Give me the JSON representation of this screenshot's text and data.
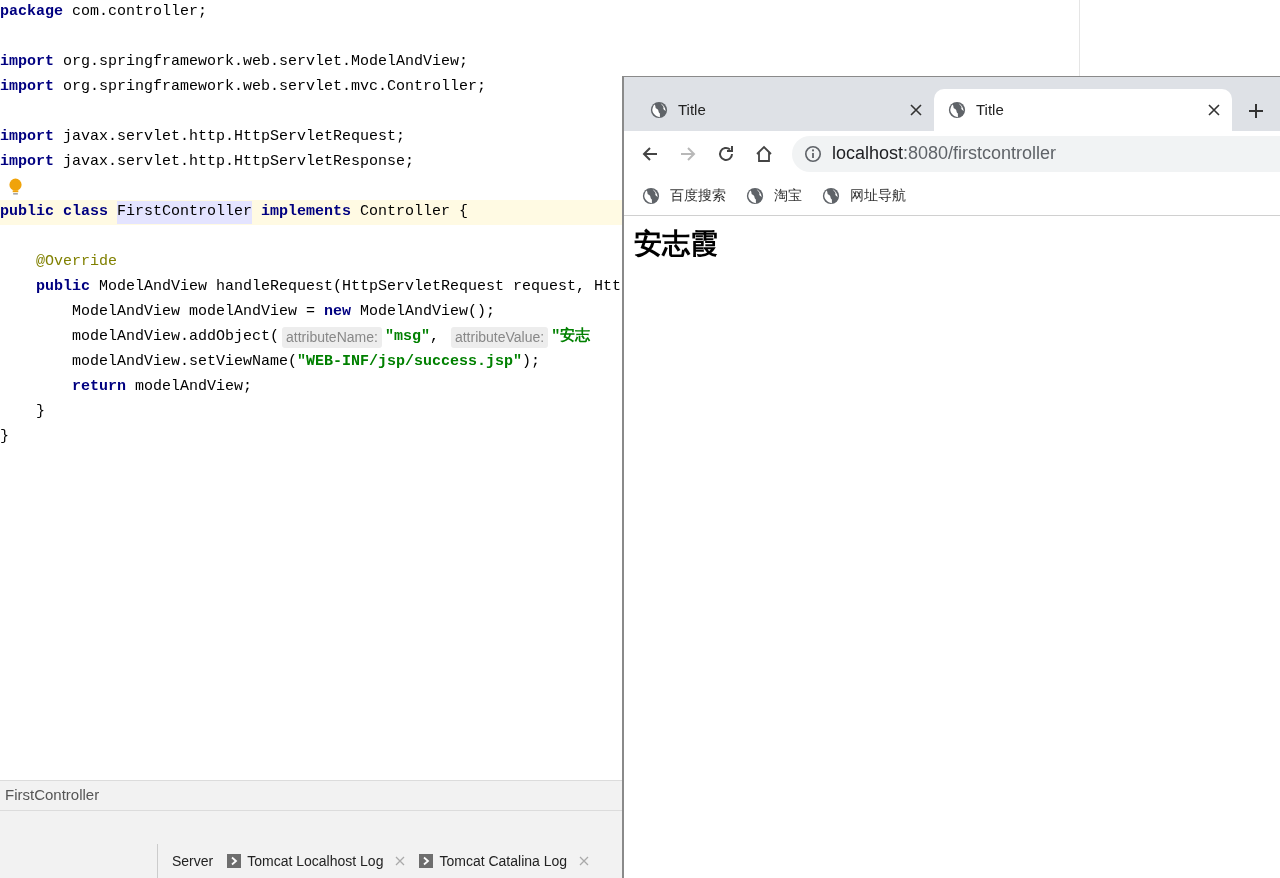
{
  "editor": {
    "lines": [
      {
        "current": false,
        "tokens": [
          {
            "kind": "keyword",
            "text": "package"
          },
          {
            "kind": "plain",
            "text": " com.controller;"
          }
        ]
      },
      {
        "current": false
      },
      {
        "current": false,
        "tokens": [
          {
            "kind": "keyword",
            "text": "import"
          },
          {
            "kind": "plain",
            "text": " org.springframework.web.servlet.ModelAndView;"
          }
        ]
      },
      {
        "current": false,
        "tokens": [
          {
            "kind": "keyword",
            "text": "import"
          },
          {
            "kind": "plain",
            "text": " org.springframework.web.servlet.mvc.Controller;"
          }
        ]
      },
      {
        "current": false
      },
      {
        "current": false,
        "tokens": [
          {
            "kind": "keyword",
            "text": "import"
          },
          {
            "kind": "plain",
            "text": " javax.servlet.http.HttpServletRequest;"
          }
        ]
      },
      {
        "current": false,
        "tokens": [
          {
            "kind": "keyword",
            "text": "import"
          },
          {
            "kind": "plain",
            "text": " javax.servlet.http.HttpServletResponse;"
          }
        ]
      },
      {
        "current": false,
        "tokens": [
          {
            "kind": "bulb"
          }
        ]
      },
      {
        "current": true,
        "tokens": [
          {
            "kind": "keyword",
            "text": "public class"
          },
          {
            "kind": "highlight",
            "text": "FirstController"
          },
          {
            "kind": "keyword",
            "text": "implements"
          },
          {
            "kind": "plain",
            "text": " Controller {"
          }
        ]
      },
      {
        "current": false
      },
      {
        "current": false,
        "tokens": [
          {
            "kind": "annotation",
            "text": "    @Override"
          }
        ]
      },
      {
        "current": false,
        "tokens": [
          {
            "kind": "keyword",
            "text": "    public"
          },
          {
            "kind": "plain",
            "text": " ModelAndView handleRequest(HttpServletRequest request, Htt"
          }
        ]
      },
      {
        "current": false,
        "tokens": [
          {
            "kind": "plain",
            "text": "        ModelAndView modelAndView = "
          },
          {
            "kind": "keyword",
            "text": "new"
          },
          {
            "kind": "plain",
            "text": " ModelAndView();"
          }
        ]
      },
      {
        "current": false,
        "tokens": [
          {
            "kind": "plain",
            "text": "        modelAndView.addObject("
          },
          {
            "kind": "hint",
            "text": "attributeName:"
          },
          {
            "kind": "string",
            "text": "\"msg\""
          },
          {
            "kind": "plain",
            "text": ", "
          },
          {
            "kind": "hint",
            "text": "attributeValue:"
          },
          {
            "kind": "string",
            "text": "\"安志"
          }
        ]
      },
      {
        "current": false,
        "tokens": [
          {
            "kind": "plain",
            "text": "        modelAndView.setViewName("
          },
          {
            "kind": "string",
            "text": "\"WEB-INF/jsp/success.jsp\""
          },
          {
            "kind": "plain",
            "text": ");"
          }
        ]
      },
      {
        "current": false,
        "tokens": [
          {
            "kind": "keyword",
            "text": "        return"
          },
          {
            "kind": "plain",
            "text": " modelAndView;"
          }
        ]
      },
      {
        "current": false,
        "tokens": [
          {
            "kind": "plain",
            "text": "    }"
          }
        ]
      },
      {
        "current": false,
        "tokens": [
          {
            "kind": "plain",
            "text": "}"
          }
        ]
      }
    ]
  },
  "breadcrumb": "FirstController",
  "bottom_tabs": [
    {
      "title": "Server",
      "kind": "plain"
    },
    {
      "title": "Tomcat Localhost Log",
      "kind": "log"
    },
    {
      "title": "Tomcat Catalina Log",
      "kind": "log"
    }
  ],
  "browser": {
    "tabs": [
      {
        "title": "Title",
        "selected": false
      },
      {
        "title": "Title",
        "selected": true
      }
    ],
    "nav": [
      {
        "kind": "back",
        "disabled": false
      },
      {
        "kind": "forward",
        "disabled": true
      },
      {
        "kind": "reload",
        "disabled": false
      },
      {
        "kind": "home",
        "disabled": false
      }
    ],
    "address": {
      "host": "localhost",
      "rest": ":8080/firstcontroller"
    },
    "bookmarks": [
      "百度搜索",
      "淘宝",
      "网址导航"
    ],
    "heading": "安志霞"
  }
}
